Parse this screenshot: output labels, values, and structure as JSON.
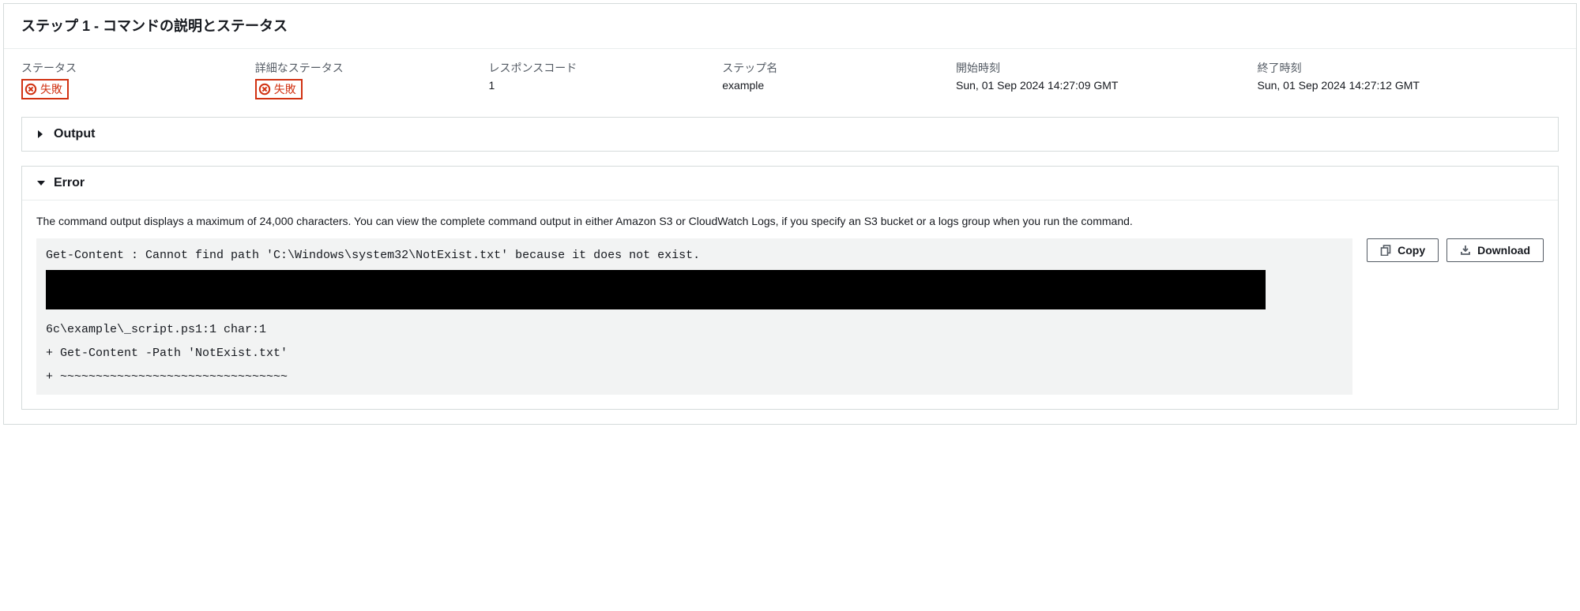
{
  "header": {
    "title": "ステップ 1 - コマンドの説明とステータス"
  },
  "status": {
    "status_label": "ステータス",
    "status_value": "失敗",
    "detailed_status_label": "詳細なステータス",
    "detailed_status_value": "失敗",
    "response_code_label": "レスポンスコード",
    "response_code_value": "1",
    "step_name_label": "ステップ名",
    "step_name_value": "example",
    "start_time_label": "開始時刻",
    "start_time_value": "Sun, 01 Sep 2024 14:27:09 GMT",
    "end_time_label": "終了時刻",
    "end_time_value": "Sun, 01 Sep 2024 14:27:12 GMT"
  },
  "sections": {
    "output_title": "Output",
    "error_title": "Error",
    "error_help": "The command output displays a maximum of 24,000 characters. You can view the complete command output in either Amazon S3 or CloudWatch Logs, if you specify an S3 bucket or a logs group when you run the command.",
    "error_lines": {
      "l1": "Get-Content : Cannot find path 'C:\\Windows\\system32\\NotExist.txt' because it does not exist.",
      "l2": "6c\\example\\_script.ps1:1 char:1",
      "l3": "+ Get-Content -Path 'NotExist.txt'",
      "l4": "+ ~~~~~~~~~~~~~~~~~~~~~~~~~~~~~~~~"
    }
  },
  "buttons": {
    "copy": "Copy",
    "download": "Download"
  }
}
